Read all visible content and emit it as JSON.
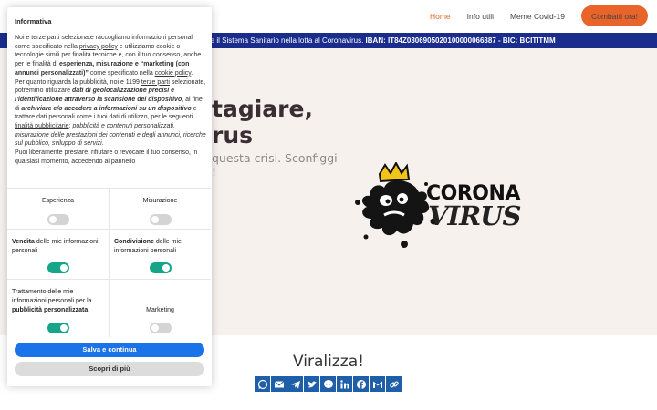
{
  "nav": {
    "items": [
      "Home",
      "Info utili",
      "Meme Covid-19"
    ],
    "active_index": 0,
    "cta_label": "Combatti ora!"
  },
  "banner": {
    "text": "re il Sistema Sanitario nella lotta al Coronavirus.",
    "iban": "IBAN: IT84Z0306905020100000066387 - BIC: BCITITMM"
  },
  "hero": {
    "title_line1": "tagiare,",
    "title_line2": "rus",
    "subtitle_line1": "questa crisi. Sconfiggi",
    "subtitle_line2": "!"
  },
  "logo": {
    "line1": "CORONA",
    "line2": "VIRUS"
  },
  "share": {
    "title": "Viralizza!",
    "buttons": [
      "whatsapp-icon",
      "email-icon",
      "telegram-icon",
      "twitter-icon",
      "messenger-icon",
      "linkedin-icon",
      "facebook-icon",
      "gmail-icon",
      "copy-link-icon"
    ]
  },
  "cookie": {
    "title": "Informativa",
    "p1_a": "Noi e terze parti selezionate raccogliamo informazioni personali come specificato nella ",
    "p1_link": "privacy policy",
    "p1_b": " e utilizziamo cookie o tecnologie simili per finalità tecniche e, con il tuo consenso, anche per le finalità di ",
    "p1_bold": "esperienza, misurazione e “marketing (con annunci personalizzati)”",
    "p1_c": " come specificato nella ",
    "p1_link2": "cookie policy",
    "p1_d": ".",
    "p2_a": "Per quanto riguarda la pubblicità, noi e 1199 ",
    "p2_link": "terze parti",
    "p2_b": " selezionate, potremmo utilizzare ",
    "p2_bi1": "dati di geolocalizzazione precisi e l’identificazione attraverso la scansione del dispositivo",
    "p2_c": ", al fine di ",
    "p2_bi2": "archiviare e/o accedere a informazioni su un dispositivo",
    "p2_d": " e trattare dati personali come i tuoi dati di utilizzo, per le seguenti ",
    "p2_link2": "finalità pubblicitarie",
    "p2_e": ": ",
    "p2_i": "pubblicità e contenuti personalizzati, misurazione delle prestazioni dei contenuti e degli annunci, ricerche sul pubblico, sviluppo di servizi.",
    "p3": "Puoi liberamente prestare, rifiutare o revocare il tuo consenso, in qualsiasi momento, accedendo al pannello",
    "options": {
      "esperienza": "Esperienza",
      "misurazione": "Misurazione",
      "vendita_bold": "Vendita",
      "vendita_rest": " delle mie informazioni personali",
      "condivisione_bold": "Condivisione",
      "condivisione_rest": " delle mie informazioni personali",
      "trattamento_a": "Trattamento delle mie informazioni personali per la ",
      "trattamento_bold": "pubblicità personalizzata",
      "marketing": "Marketing"
    },
    "toggles": {
      "esperienza": "off",
      "misurazione": "off",
      "vendita": "on",
      "condivisione": "on",
      "trattamento": "on",
      "marketing": "off"
    },
    "save_label": "Salva e continua",
    "more_label": "Scopri di più"
  },
  "colors": {
    "accent": "#e8642b",
    "banner": "#1a2d8c",
    "toggle_on": "#17a589",
    "toggle_off": "#d4d4d4",
    "primary_button": "#1a73e8",
    "share_button": "#1f5ea8"
  }
}
